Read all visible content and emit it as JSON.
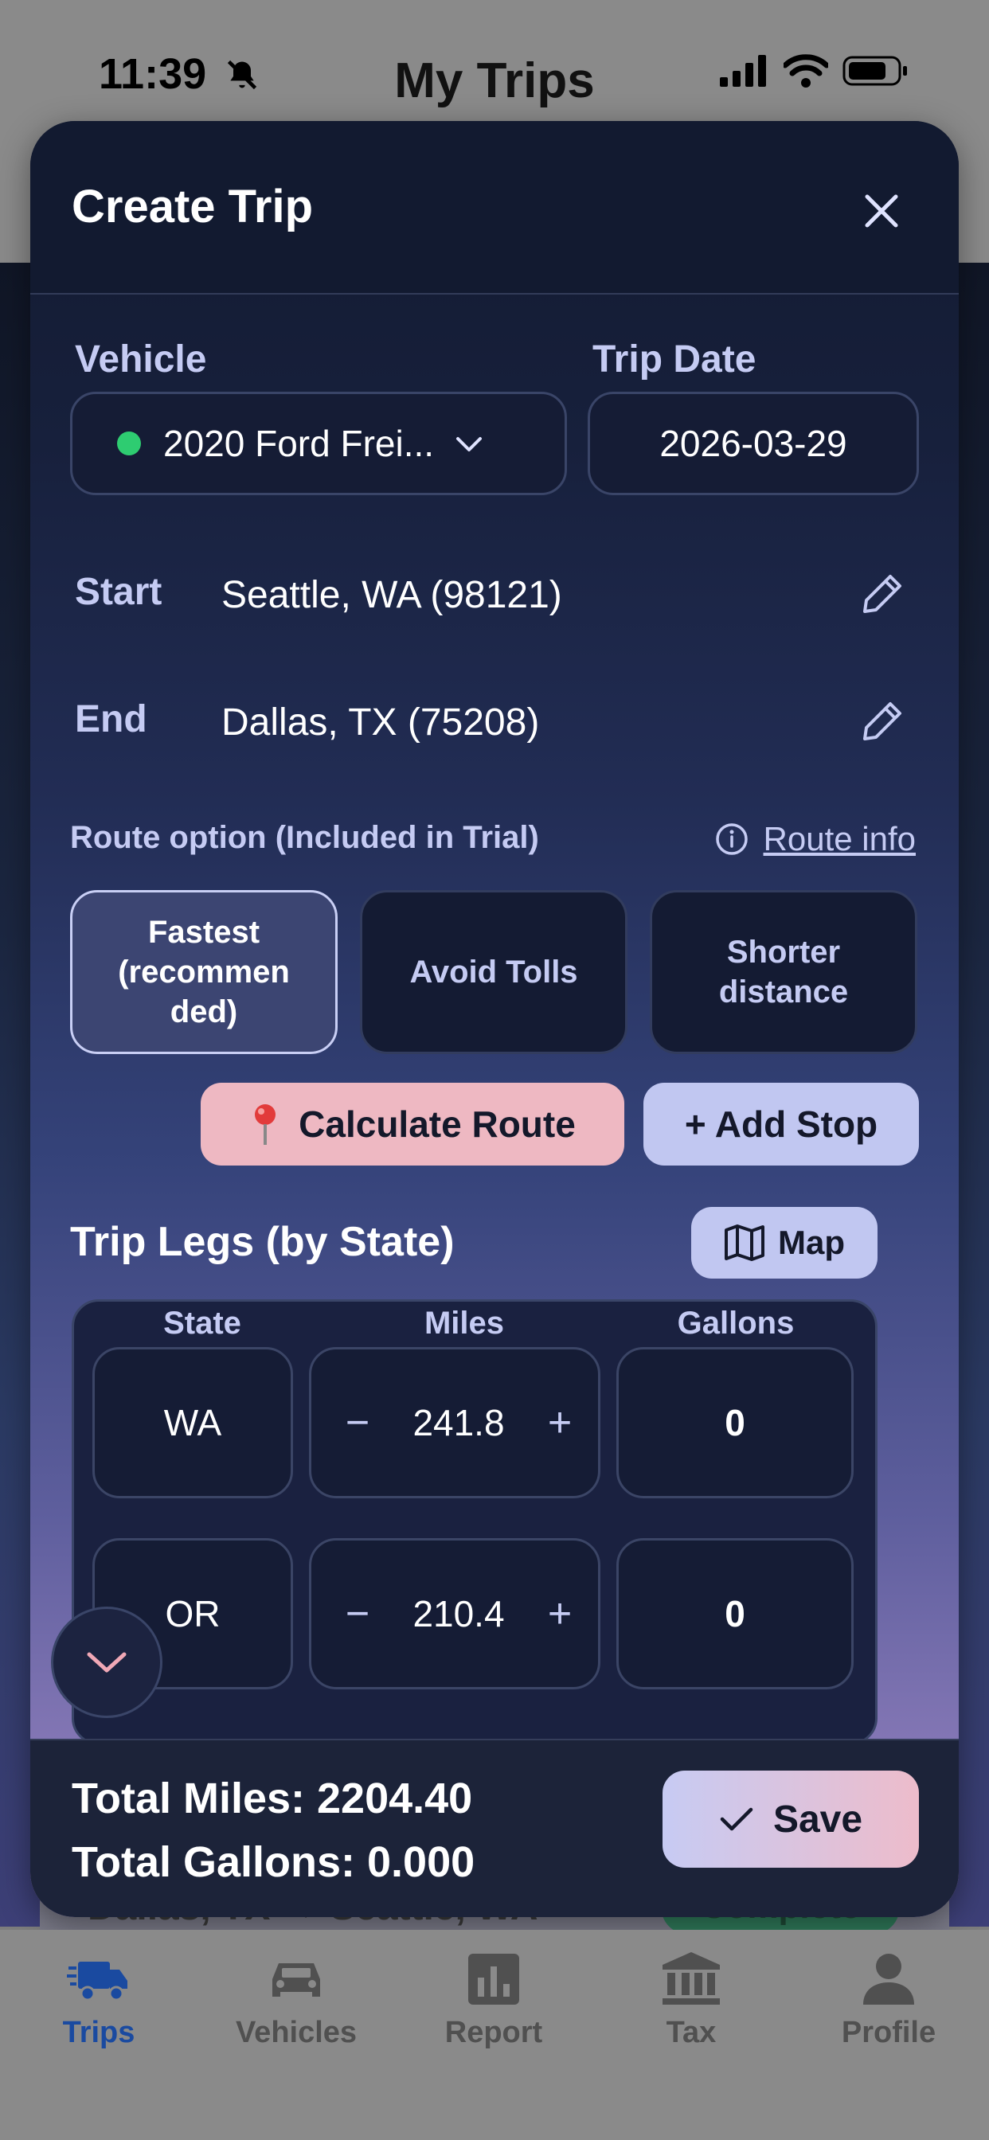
{
  "status_bar": {
    "time": "11:39"
  },
  "background": {
    "title": "My Trips",
    "card_route": "Dallas, TX → Seattle, WA",
    "card_badge": "Complete"
  },
  "modal": {
    "title": "Create Trip",
    "vehicle": {
      "label": "Vehicle",
      "value": "2020 Ford Frei..."
    },
    "trip_date": {
      "label": "Trip Date",
      "value": "2026-03-29"
    },
    "start": {
      "label": "Start",
      "value": "Seattle, WA (98121)"
    },
    "end": {
      "label": "End",
      "value": "Dallas, TX (75208)"
    },
    "route_option": {
      "label": "Route option ",
      "trial_note": "(Included in Trial)",
      "info_link": "Route info",
      "options": [
        {
          "label": "Fastest (recommen ded)",
          "selected": true
        },
        {
          "label": "Avoid Tolls",
          "selected": false
        },
        {
          "label": "Shorter distance",
          "selected": false
        }
      ]
    },
    "calculate_label": "Calculate Route",
    "add_stop_label": "+ Add Stop",
    "legs": {
      "title": "Trip Legs (by State)",
      "map_label": "Map",
      "headers": [
        "State",
        "Miles",
        "Gallons"
      ],
      "rows": [
        {
          "state": "WA",
          "miles": "241.8",
          "gallons": "0"
        },
        {
          "state": "OR",
          "miles": "210.4",
          "gallons": "0"
        }
      ]
    },
    "totals": {
      "miles": "Total Miles: 2204.40",
      "gallons": "Total Gallons: 0.000"
    },
    "save_label": "Save"
  },
  "tabs": [
    {
      "label": "Trips",
      "icon": "truck-icon",
      "active": true
    },
    {
      "label": "Vehicles",
      "icon": "car-icon",
      "active": false
    },
    {
      "label": "Report",
      "icon": "report-icon",
      "active": false
    },
    {
      "label": "Tax",
      "icon": "bank-icon",
      "active": false
    },
    {
      "label": "Profile",
      "icon": "person-icon",
      "active": false
    }
  ],
  "colors": {
    "accent_pink": "#eeb8c2",
    "accent_lavender": "#c1c7f1",
    "active_tab": "#1a4aa0",
    "vehicle_status": "#2ecc71"
  }
}
